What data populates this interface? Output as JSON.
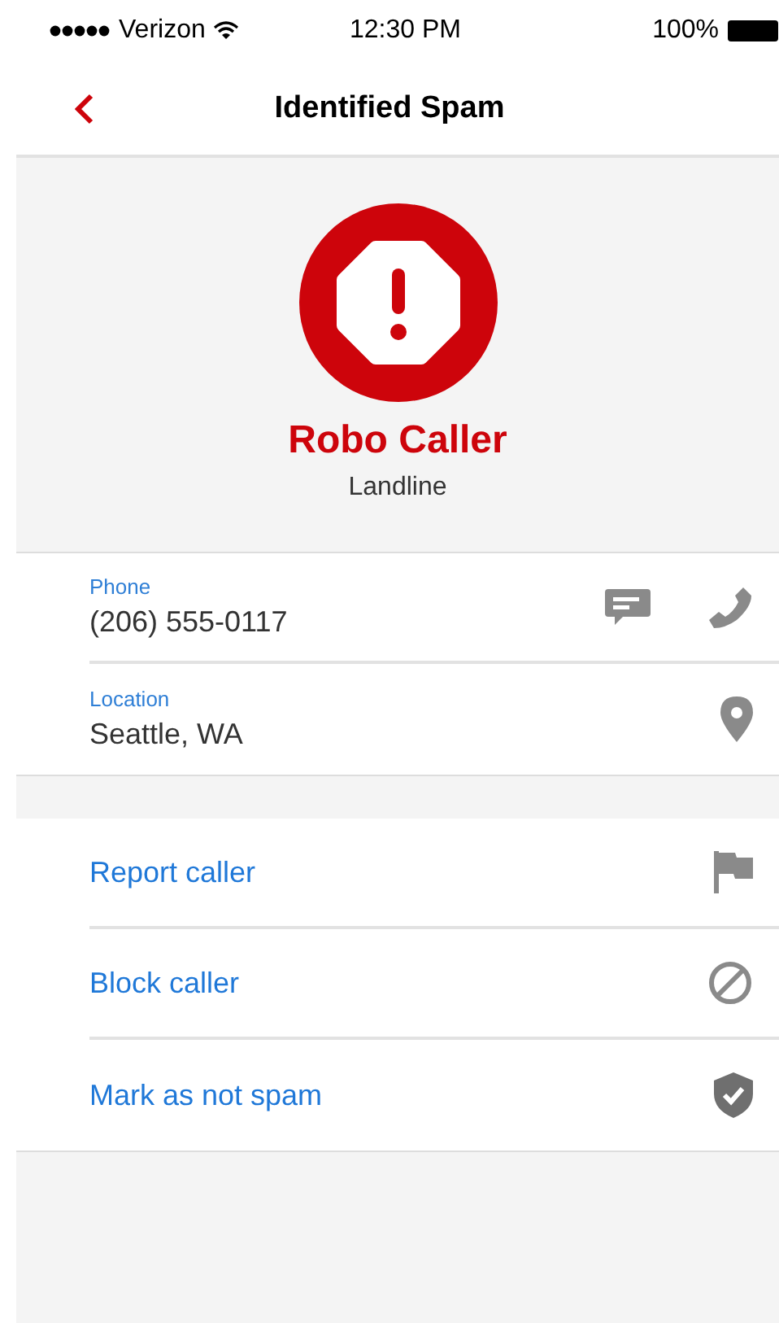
{
  "status_bar": {
    "carrier": "Verizon",
    "time": "12:30 PM",
    "battery": "100%"
  },
  "nav": {
    "title": "Identified Spam"
  },
  "caller": {
    "name": "Robo Caller",
    "type": "Landline"
  },
  "details": [
    {
      "label": "Phone",
      "value": "(206) 555-0117"
    },
    {
      "label": "Location",
      "value": "Seattle, WA"
    }
  ],
  "actions": [
    "Report caller",
    "Block caller",
    "Mark as not spam"
  ]
}
